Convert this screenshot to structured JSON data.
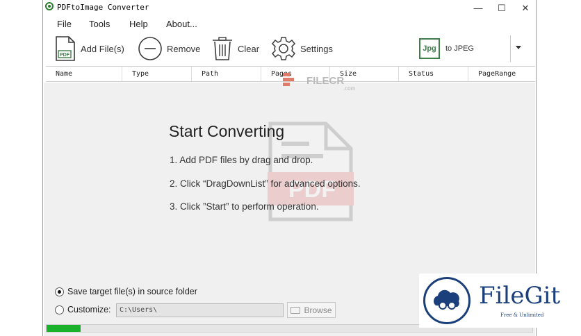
{
  "window": {
    "title": "PDFtoImage Converter",
    "controls": {
      "minimize": "—",
      "maximize": "☐",
      "close": "✕"
    }
  },
  "menu": [
    "File",
    "Tools",
    "Help",
    "About..."
  ],
  "toolbar": {
    "add_files": "Add File(s)",
    "remove": "Remove",
    "clear": "Clear",
    "settings": "Settings",
    "format_icon": "Jpg",
    "format_label": "to JPEG"
  },
  "columns": [
    "Name",
    "Type",
    "Path",
    "Pages",
    "Size",
    "Status",
    "PageRange"
  ],
  "start": {
    "title": "Start Converting",
    "steps": [
      "1. Add PDF files by drag and drop.",
      "2. Click “DragDownList” for advanced options.",
      "3. Click ”Start” to perform operation."
    ],
    "doc_badge": "PDF"
  },
  "output": {
    "save_source_label": "Save target file(s) in source folder",
    "save_source_selected": true,
    "customize_label": "Customize:",
    "path_value": "C:\\Users\\",
    "browse_label": "Browse"
  },
  "progress": {
    "value": 0.07,
    "color": "#19b22a"
  },
  "watermarks": {
    "filecr": {
      "text": "FILECR",
      "suffix": ".com"
    },
    "filegit": {
      "text": "FileGit",
      "tagline": "Free & Unlimited"
    }
  },
  "colors": {
    "accent_green": "#3f7d4a",
    "progress_green": "#19b22a",
    "filegit_blue": "#1a3f7a"
  }
}
